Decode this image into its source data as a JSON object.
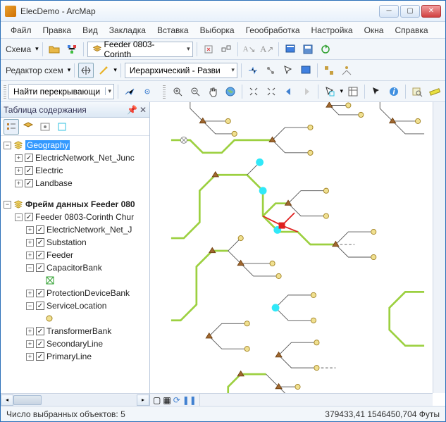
{
  "title": "ElecDemo - ArcMap",
  "menu": [
    "Файл",
    "Правка",
    "Вид",
    "Закладка",
    "Вставка",
    "Выборка",
    "Геообработка",
    "Настройка",
    "Окна",
    "Справка"
  ],
  "tb1": {
    "schema_label": "Схема",
    "layer_select": "Feeder 0803-Corinth"
  },
  "tb2": {
    "editor_label": "Редактор схем",
    "layout_select": "Иерархический - Разви"
  },
  "tb3": {
    "find_label": "Найти перекрывающи"
  },
  "toc": {
    "title": "Таблица содержания",
    "group1": "Geography",
    "g1_items": [
      "ElectricNetwork_Net_Junc",
      "Electric",
      "Landbase"
    ],
    "group2": "Фрейм данных Feeder 080",
    "g2_feeder": "Feeder 0803-Corinth Chur",
    "g2_items": [
      "ElectricNetwork_Net_J",
      "Substation",
      "Feeder",
      "CapacitorBank",
      "ProtectionDeviceBank",
      "ServiceLocation",
      "TransformerBank",
      "SecondaryLine",
      "PrimaryLine"
    ]
  },
  "status": {
    "selected": "Число выбранных объектов: 5",
    "coords": "379433,41 1546450,704 Футы"
  }
}
